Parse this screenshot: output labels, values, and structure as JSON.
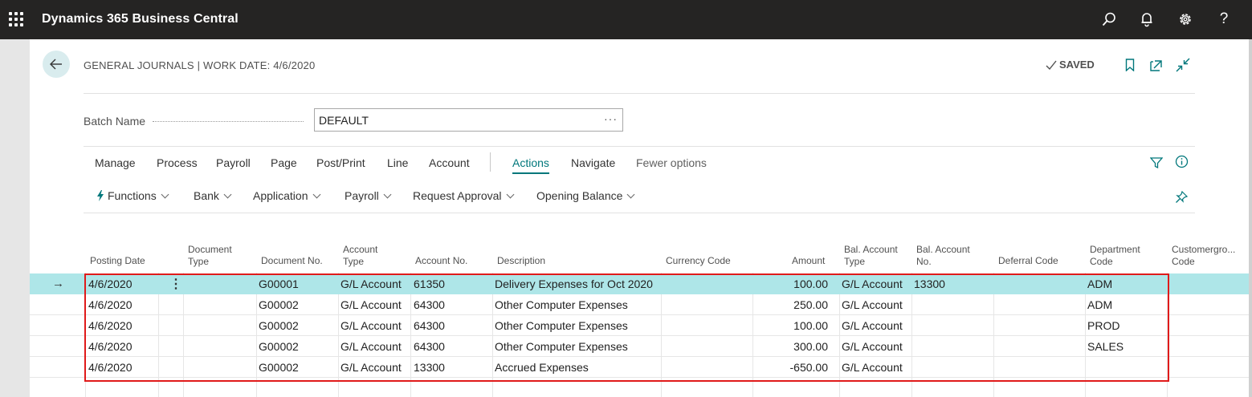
{
  "app": {
    "title": "Dynamics 365 Business Central",
    "icons": [
      "waffle-icon",
      "search-icon",
      "bell-icon",
      "gear-icon",
      "help-icon"
    ]
  },
  "header": {
    "title": "GENERAL JOURNALS | WORK DATE: 4/6/2020",
    "saved_label": "SAVED",
    "help_glyph": "?"
  },
  "batch": {
    "label": "Batch Name",
    "value": "DEFAULT",
    "more": "···"
  },
  "menu": {
    "items": [
      "Manage",
      "Process",
      "Payroll",
      "Page",
      "Post/Print",
      "Line",
      "Account",
      "Actions",
      "Navigate",
      "Fewer options"
    ],
    "active": "Actions"
  },
  "submenu": {
    "items": [
      "Functions",
      "Bank",
      "Application",
      "Payroll",
      "Request Approval",
      "Opening Balance"
    ]
  },
  "grid": {
    "headers": [
      [
        "Posting Date"
      ],
      [
        "Document",
        "Type"
      ],
      [
        "Document No."
      ],
      [
        "Account",
        "Type"
      ],
      [
        "Account No."
      ],
      [
        "Description"
      ],
      [
        "Currency Code"
      ],
      [
        "Amount"
      ],
      [
        "Bal. Account",
        "Type"
      ],
      [
        "Bal. Account",
        "No."
      ],
      [
        "Deferral Code"
      ],
      [
        "Department",
        "Code"
      ],
      [
        "Customergro...",
        "Code"
      ]
    ],
    "rows": [
      {
        "posting_date": "4/6/2020",
        "doc_type": "",
        "doc_no": "G00001",
        "acct_type": "G/L Account",
        "acct_no": "61350",
        "description": "Delivery Expenses for Oct 2020",
        "currency": "",
        "amount": "100.00",
        "bal_type": "G/L Account",
        "bal_no": "13300",
        "deferral": "",
        "dept": "ADM",
        "custgroup": ""
      },
      {
        "posting_date": "4/6/2020",
        "doc_type": "",
        "doc_no": "G00002",
        "acct_type": "G/L Account",
        "acct_no": "64300",
        "description": "Other Computer Expenses",
        "currency": "",
        "amount": "250.00",
        "bal_type": "G/L Account",
        "bal_no": "",
        "deferral": "",
        "dept": "ADM",
        "custgroup": ""
      },
      {
        "posting_date": "4/6/2020",
        "doc_type": "",
        "doc_no": "G00002",
        "acct_type": "G/L Account",
        "acct_no": "64300",
        "description": "Other Computer Expenses",
        "currency": "",
        "amount": "100.00",
        "bal_type": "G/L Account",
        "bal_no": "",
        "deferral": "",
        "dept": "PROD",
        "custgroup": ""
      },
      {
        "posting_date": "4/6/2020",
        "doc_type": "",
        "doc_no": "G00002",
        "acct_type": "G/L Account",
        "acct_no": "64300",
        "description": "Other Computer Expenses",
        "currency": "",
        "amount": "300.00",
        "bal_type": "G/L Account",
        "bal_no": "",
        "deferral": "",
        "dept": "SALES",
        "custgroup": ""
      },
      {
        "posting_date": "4/6/2020",
        "doc_type": "",
        "doc_no": "G00002",
        "acct_type": "G/L Account",
        "acct_no": "13300",
        "description": "Accrued Expenses",
        "currency": "",
        "amount": "-650.00",
        "bal_type": "G/L Account",
        "bal_no": "",
        "deferral": "",
        "dept": "",
        "custgroup": ""
      }
    ],
    "selected_row": 0
  },
  "colors": {
    "topbar": "#252423",
    "accent": "#00777b",
    "selected_row": "#aee6e8",
    "highlight_border": "#e01a1a"
  }
}
